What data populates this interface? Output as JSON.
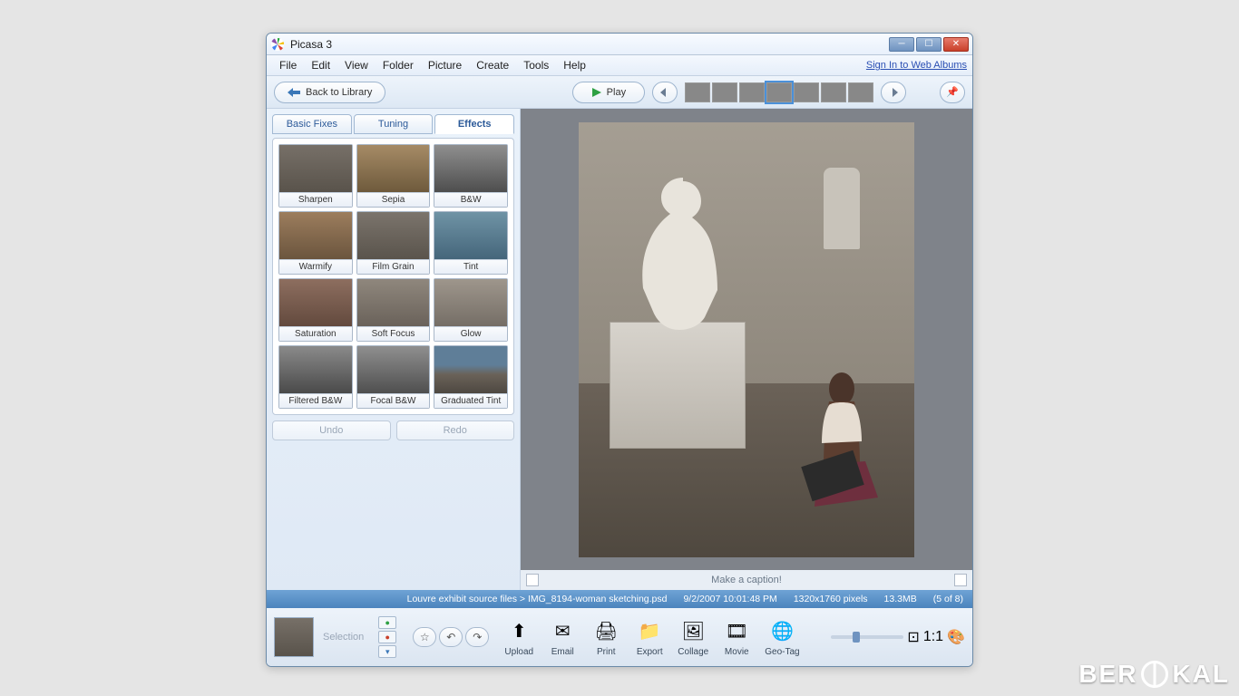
{
  "window": {
    "title": "Picasa 3"
  },
  "menu": {
    "items": [
      "File",
      "Edit",
      "View",
      "Folder",
      "Picture",
      "Create",
      "Tools",
      "Help"
    ],
    "signin": "Sign In to Web Albums"
  },
  "toolbar": {
    "back_label": "Back to Library",
    "play_label": "Play",
    "strip_count": 7,
    "strip_selected_index": 3
  },
  "tabs": {
    "items": [
      "Basic Fixes",
      "Tuning",
      "Effects"
    ],
    "active_index": 2
  },
  "effects": [
    {
      "label": "Sharpen",
      "cls": "f-normal"
    },
    {
      "label": "Sepia",
      "cls": "f-sepia"
    },
    {
      "label": "B&W",
      "cls": "f-bw"
    },
    {
      "label": "Warmify",
      "cls": "f-warm"
    },
    {
      "label": "Film Grain",
      "cls": "f-grain"
    },
    {
      "label": "Tint",
      "cls": "f-tint"
    },
    {
      "label": "Saturation",
      "cls": "f-sat"
    },
    {
      "label": "Soft Focus",
      "cls": "f-soft"
    },
    {
      "label": "Glow",
      "cls": "f-glow"
    },
    {
      "label": "Filtered B&W",
      "cls": "f-fbw"
    },
    {
      "label": "Focal B&W",
      "cls": "f-focbw"
    },
    {
      "label": "Graduated Tint",
      "cls": "f-grad"
    }
  ],
  "undo": {
    "undo_label": "Undo",
    "redo_label": "Redo"
  },
  "caption": {
    "placeholder": "Make a caption!"
  },
  "status": {
    "path": "Louvre exhibit source files > IMG_8194-woman sketching.psd",
    "datetime": "9/2/2007 10:01:48 PM",
    "dimensions": "1320x1760 pixels",
    "size": "13.3MB",
    "position": "(5 of 8)"
  },
  "selection": {
    "label": "Selection"
  },
  "actions": [
    {
      "label": "Upload",
      "icon": "upload"
    },
    {
      "label": "Email",
      "icon": "email"
    },
    {
      "label": "Print",
      "icon": "print"
    },
    {
      "label": "Export",
      "icon": "export"
    },
    {
      "label": "Collage",
      "icon": "collage"
    },
    {
      "label": "Movie",
      "icon": "movie"
    },
    {
      "label": "Geo-Tag",
      "icon": "geotag"
    }
  ],
  "watermark": {
    "text_before": "BER",
    "text_after": "KAL"
  }
}
